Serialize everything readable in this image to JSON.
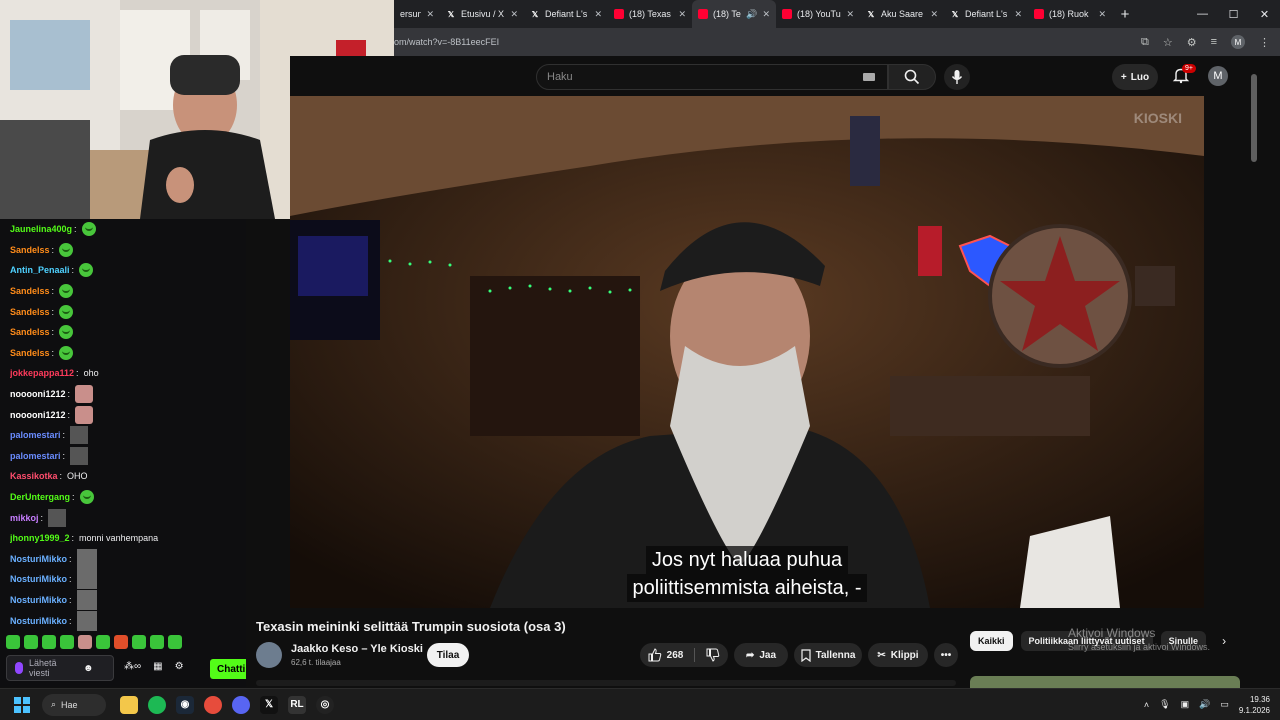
{
  "browser": {
    "tabs": [
      {
        "label": "ersun",
        "icon": "none"
      },
      {
        "label": "Etusivu / X",
        "icon": "x"
      },
      {
        "label": "Defiant L's",
        "icon": "x"
      },
      {
        "label": "(18) Texas",
        "icon": "youtube"
      },
      {
        "label": "(18) Te",
        "icon": "youtube",
        "active": true
      },
      {
        "label": "(18) YouTu",
        "icon": "youtube"
      },
      {
        "label": "Aku Saare",
        "icon": "x"
      },
      {
        "label": "Defiant L's",
        "icon": "x"
      },
      {
        "label": "(18) Ruok",
        "icon": "youtube"
      }
    ],
    "url": "om/watch?v=-8B11eecFEI",
    "profile_initial": "M"
  },
  "youtube": {
    "search_placeholder": "Haku",
    "create_label": "Luo",
    "notifications_badge": "9+",
    "avatar_initial": "M",
    "subtitle_line1": "Jos nyt haluaa puhua",
    "subtitle_line2": "poliittisemmista aiheista, -",
    "video_title": "Texasin meininki selittää Trumpin suosiota (osa 3)",
    "channel_name": "Jaakko Keso – Yle Kioski",
    "channel_subs": "62,6 t. tilaajaa",
    "subscribe_label": "Tilaa",
    "like_count": "268",
    "share_label": "Jaa",
    "save_label": "Tallenna",
    "clip_label": "Klippi",
    "chips": [
      "Kaikki",
      "Politiikkaan liittyvät uutiset",
      "Sinulle"
    ],
    "watermark": "KIOSKI"
  },
  "windows_activation": {
    "line1": "Aktivoi Windows",
    "line2": "Siirry asetuksiin ja aktivoi Windows."
  },
  "chat": {
    "messages": [
      {
        "user": "Jaunelina400g",
        "color": "#53fc18",
        "text": "",
        "emote": "green"
      },
      {
        "user": "Sandelss",
        "color": "#ff8c1a",
        "text": "",
        "emote": "green"
      },
      {
        "user": "Antin_Penaali",
        "color": "#4fd1ff",
        "text": "",
        "emote": "green"
      },
      {
        "user": "Sandelss",
        "color": "#ff8c1a",
        "text": "",
        "emote": "green"
      },
      {
        "user": "Sandelss",
        "color": "#ff8c1a",
        "text": "",
        "emote": "green"
      },
      {
        "user": "Sandelss",
        "color": "#ff8c1a",
        "text": "",
        "emote": "green"
      },
      {
        "user": "Sandelss",
        "color": "#ff8c1a",
        "text": "",
        "emote": "green"
      },
      {
        "user": "jokkepappa112",
        "color": "#ff3b5c",
        "text": "oho",
        "emote": "none"
      },
      {
        "user": "nooooni1212",
        "color": "#ffffff",
        "text": "",
        "emote": "cat"
      },
      {
        "user": "nooooni1212",
        "color": "#ffffff",
        "text": "",
        "emote": "cat"
      },
      {
        "user": "palomestari",
        "color": "#6a8cff",
        "text": "",
        "emote": "gray"
      },
      {
        "user": "palomestari",
        "color": "#6a8cff",
        "text": "",
        "emote": "gray"
      },
      {
        "user": "Kassikotka",
        "color": "#ff4d6d",
        "text": "OHO",
        "emote": "none"
      },
      {
        "user": "DerUntergang",
        "color": "#53fc18",
        "text": "",
        "emote": "green"
      },
      {
        "user": "mikkoj",
        "color": "#c77dff",
        "text": "",
        "emote": "gray"
      },
      {
        "user": "jhonny1999_2",
        "color": "#53fc18",
        "text": "monni vanhempana",
        "emote": "none"
      },
      {
        "user": "NosturiMikko",
        "color": "#6ab0ff",
        "text": "",
        "emote": "gray2"
      },
      {
        "user": "NosturiMikko",
        "color": "#6ab0ff",
        "text": "",
        "emote": "gray2"
      },
      {
        "user": "NosturiMikko",
        "color": "#6ab0ff",
        "text": "",
        "emote": "gray2"
      },
      {
        "user": "NosturiMikko",
        "color": "#6ab0ff",
        "text": "",
        "emote": "gray2"
      }
    ],
    "input_placeholder": "Lähetä viesti",
    "send_label": "Chatti"
  },
  "taskbar": {
    "search_label": "Hae",
    "time": "19.36",
    "date": "9.1.2026"
  }
}
